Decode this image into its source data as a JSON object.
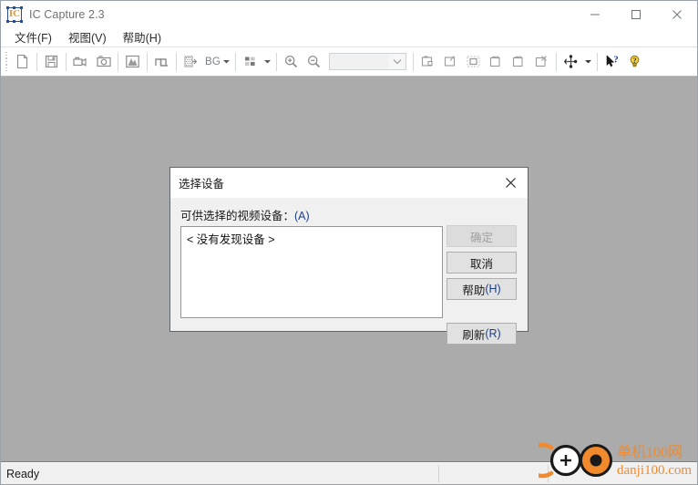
{
  "window": {
    "title": "IC Capture 2.3",
    "icon": "app-ic-capture-icon",
    "controls": {
      "minimize": "minimize-icon",
      "maximize": "maximize-icon",
      "close": "close-icon"
    }
  },
  "menubar": {
    "items": [
      {
        "label": "文件(F)",
        "name": "menu-file"
      },
      {
        "label": "视图(V)",
        "name": "menu-view"
      },
      {
        "label": "帮助(H)",
        "name": "menu-help"
      }
    ]
  },
  "toolbar": {
    "bg_label": "BG",
    "combo_value": "",
    "buttons": [
      {
        "name": "new-device-icon"
      },
      {
        "name": "save-icon"
      },
      {
        "name": "record-video-icon"
      },
      {
        "name": "snapshot-camera-icon"
      },
      {
        "name": "histogram-icon"
      },
      {
        "name": "trigger-pulse-icon"
      },
      {
        "name": "background-remove-icon"
      },
      {
        "name": "grid-overlay-icon"
      },
      {
        "name": "zoom-in-icon"
      },
      {
        "name": "zoom-out-icon"
      },
      {
        "name": "device-properties-icon"
      },
      {
        "name": "image-settings-icon"
      },
      {
        "name": "roi-region-icon"
      },
      {
        "name": "window-capture-icon"
      },
      {
        "name": "window-snapshot-icon"
      },
      {
        "name": "window-close-capture-icon"
      },
      {
        "name": "device-connection-icon"
      },
      {
        "name": "context-help-icon"
      },
      {
        "name": "help-about-icon"
      }
    ]
  },
  "dialog": {
    "title": "选择设备",
    "list_label_main": "可供选择的视频设备：",
    "list_label_accel": "(A)",
    "list_items": [
      "< 没有发现设备 >"
    ],
    "buttons": {
      "ok": {
        "label": "确定",
        "accel": "",
        "disabled": true
      },
      "cancel": {
        "label": "取消",
        "accel": "",
        "disabled": false
      },
      "help": {
        "label": "帮助",
        "accel": "(H)",
        "disabled": false
      },
      "refresh": {
        "label": "刷新",
        "accel": "(R)",
        "disabled": false
      }
    },
    "close_icon": "close-icon"
  },
  "statusbar": {
    "text": "Ready"
  },
  "watermark": {
    "site_cn": "单机100网",
    "site_url": "danji100.com"
  },
  "colors": {
    "workspace_bg": "#ababab",
    "chrome_bg": "#ffffff",
    "dialog_bg": "#f0f0f0",
    "button_bg": "#e1e1e1",
    "accel_blue": "#1b3f8b",
    "icon_gray": "#9a9a9a",
    "watermark_orange": "#f08a2c"
  }
}
